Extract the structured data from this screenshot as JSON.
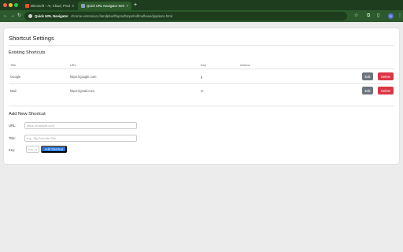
{
  "browser": {
    "tabs": [
      {
        "title": "Microsoft – AI, Cloud, Produ",
        "active": false,
        "favicon_color": "#f25022"
      },
      {
        "title": "Quick URL Navigator Settings",
        "active": true,
        "favicon_color": "#8aa0b8"
      }
    ],
    "close_glyph": "×",
    "new_tab_glyph": "+",
    "address": {
      "site_name": "Quick URL Navigator",
      "url": "chrome-extension://amdpbodflopmdhmpnbolfmefkasedjoptions.html"
    },
    "icons": [
      "back-icon",
      "forward-icon",
      "reload-icon",
      "extension-icon",
      "star-icon",
      "puzzle-icon",
      "sidepanel-icon",
      "profile-icon",
      "menu-icon"
    ],
    "profile_initial": "S"
  },
  "page": {
    "title": "Shortcut Settings",
    "existing": {
      "heading": "Existing Shortcuts",
      "columns": {
        "title": "Title",
        "url": "URL",
        "key": "Key",
        "actions": "Actions"
      },
      "rows": [
        {
          "title": "Google",
          "url": "https://google.com",
          "key": "g"
        },
        {
          "title": "Mail",
          "url": "https://gmail.com",
          "key": "m"
        }
      ],
      "edit_label": "Edit",
      "delete_label": "Delete"
    },
    "add": {
      "heading": "Add New Shortcut",
      "url_label": "URL:",
      "url_placeholder": "https://example.com",
      "title_label": "Title:",
      "title_placeholder": "e.g., My Favorite Site",
      "key_label": "Key:",
      "key_placeholder": "e.g., a",
      "add_label": "Add Shortcut"
    }
  },
  "colors": {
    "chrome_dark": "#1e3d1e",
    "chrome_toolbar": "#2c5a2c",
    "edit_button": "#6c757d",
    "delete_button": "#dc3545",
    "primary_button": "#1a73e8",
    "page_background": "#ececec"
  }
}
